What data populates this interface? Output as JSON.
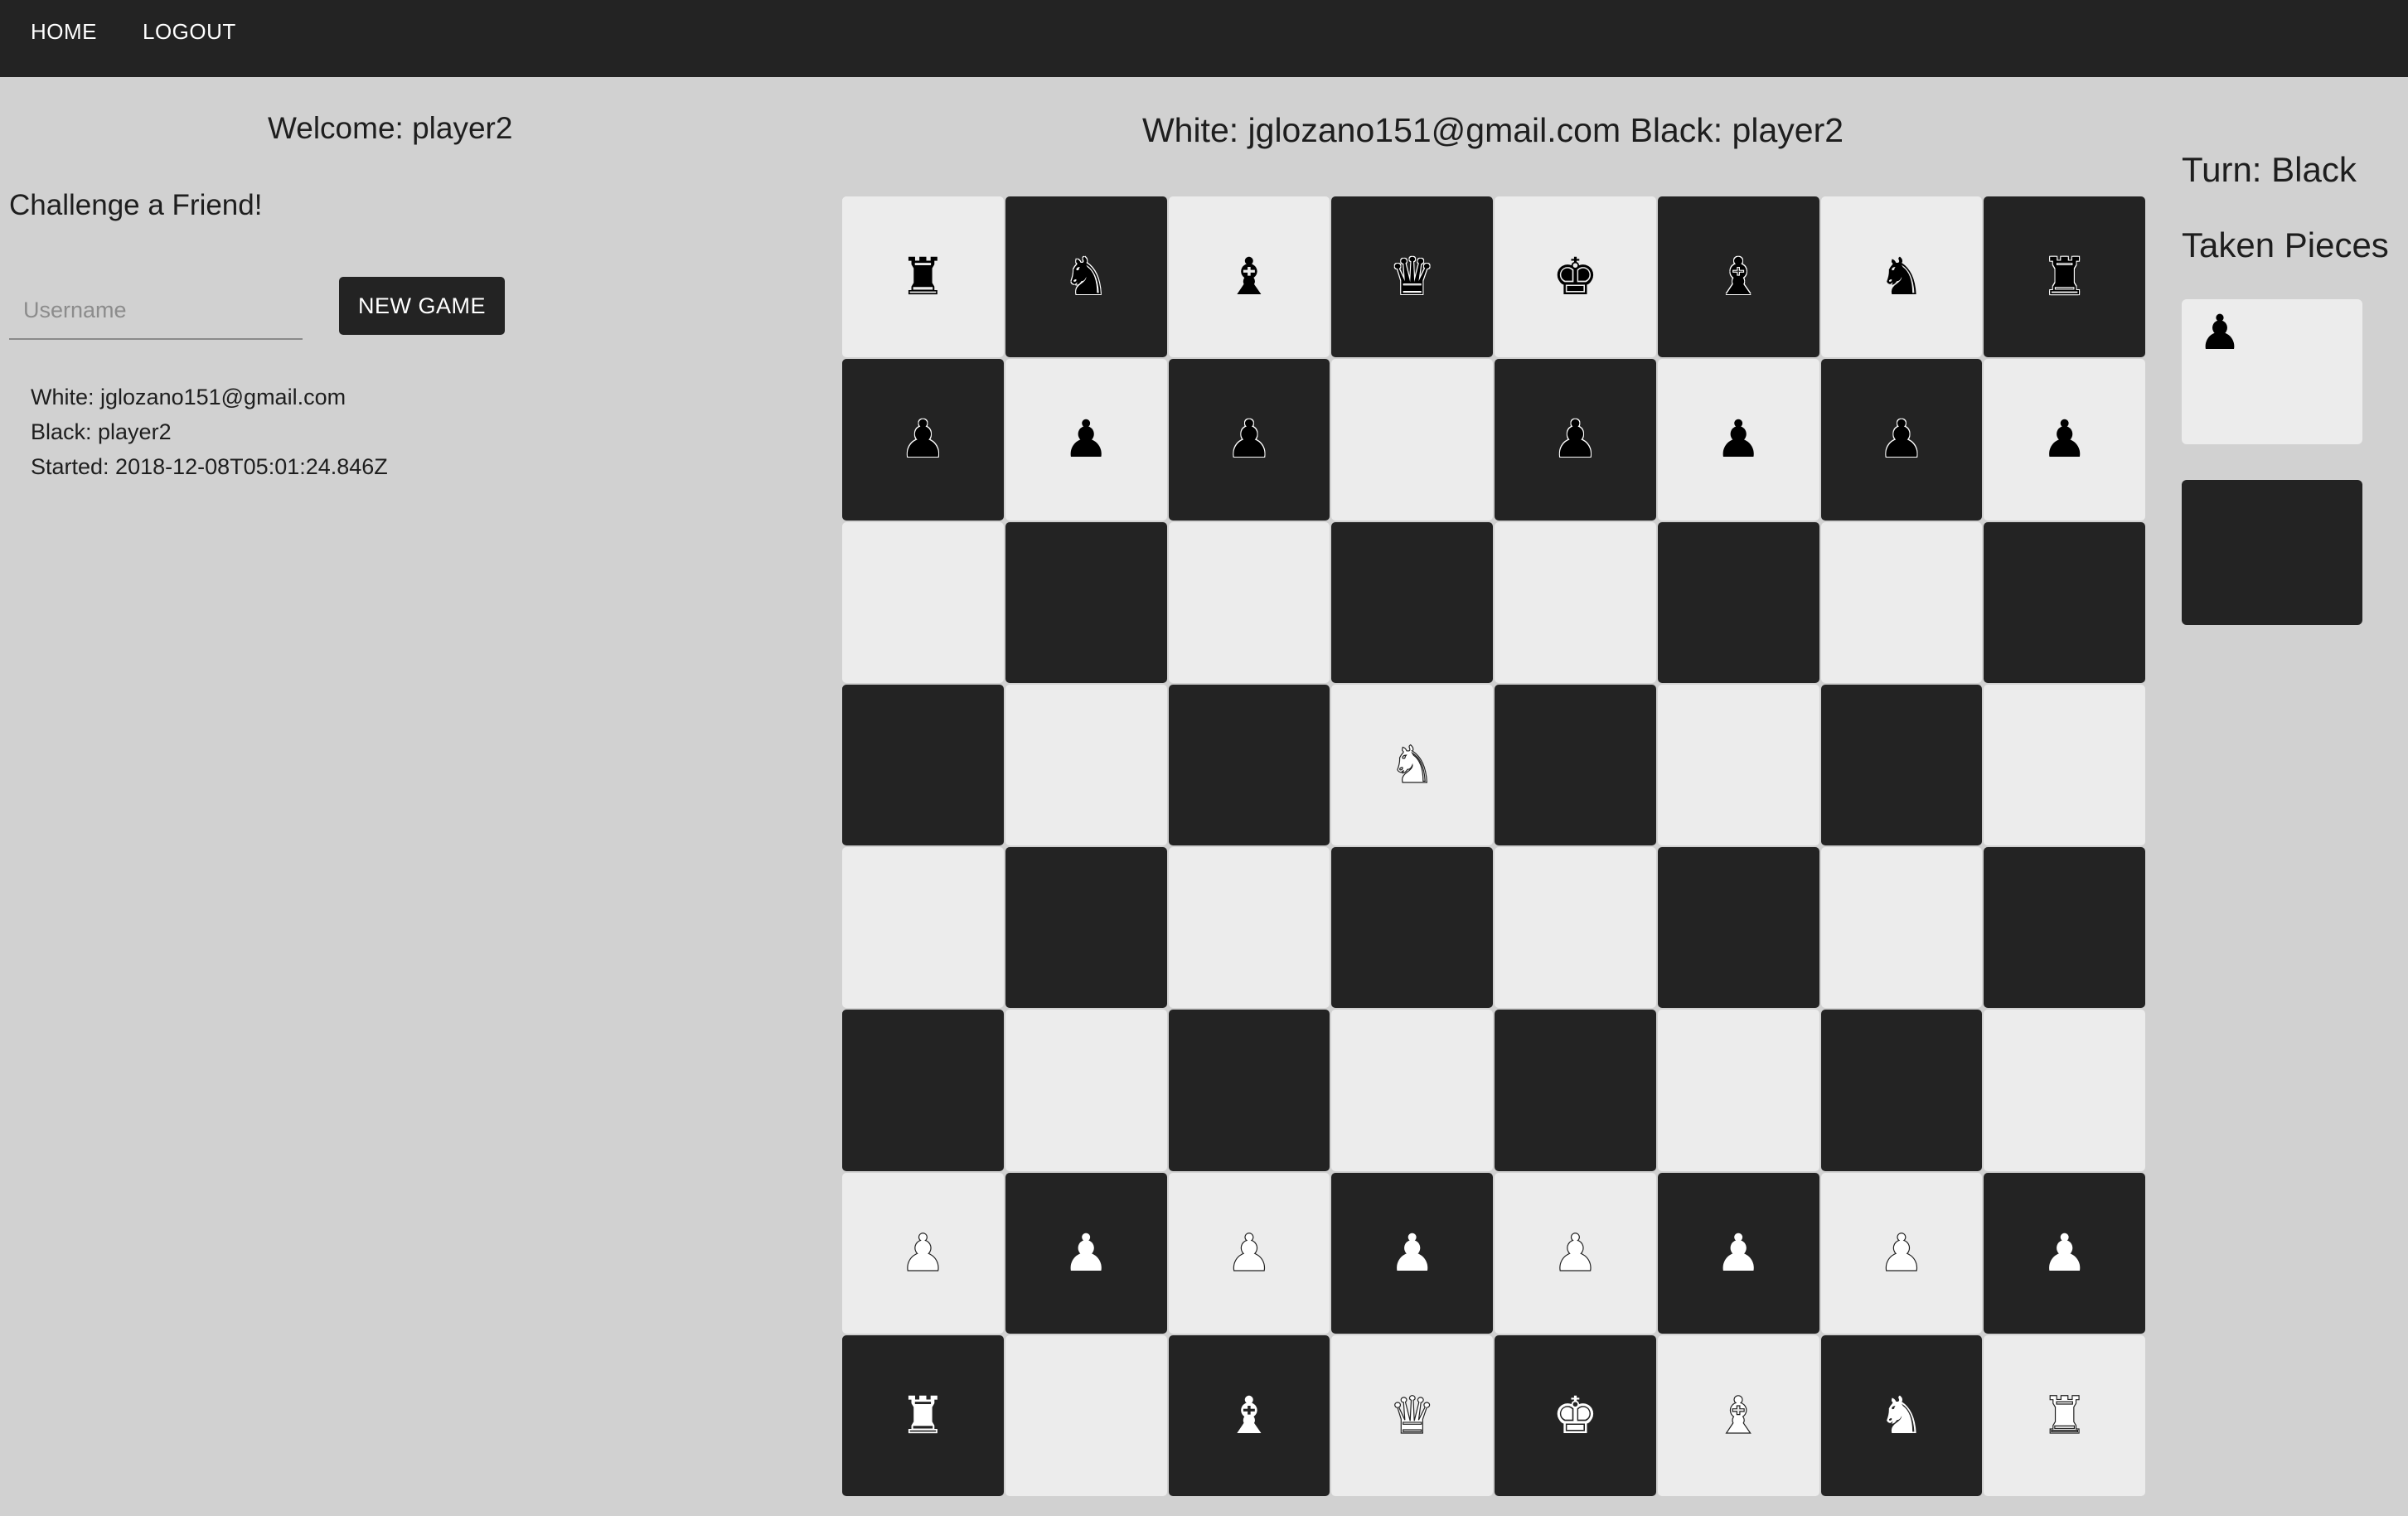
{
  "nav": {
    "home": "HOME",
    "logout": "LOGOUT"
  },
  "sidebar": {
    "welcome": "Welcome: player2",
    "challenge_heading": "Challenge a Friend!",
    "username_placeholder": "Username",
    "username_value": "",
    "new_game_label": "NEW GAME",
    "games": [
      {
        "white": "White: jglozano151@gmail.com",
        "black": "Black: player2",
        "started": "Started: 2018-12-08T05:01:24.846Z"
      }
    ]
  },
  "game": {
    "players_header": "White: jglozano151@gmail.com Black: player2",
    "turn": "Turn: Black",
    "taken_label": "Taken Pieces",
    "taken_by_white": [
      "♟"
    ],
    "taken_by_black": [],
    "board": [
      [
        "br",
        "bn",
        "bb",
        "bq",
        "bk",
        "bb",
        "bn",
        "br"
      ],
      [
        "bp",
        "bp",
        "bp",
        "",
        "bp",
        "bp",
        "bp",
        "bp"
      ],
      [
        "",
        "",
        "",
        "",
        "",
        "",
        "",
        ""
      ],
      [
        "",
        "",
        "",
        "wn",
        "",
        "",
        "",
        ""
      ],
      [
        "",
        "",
        "",
        "",
        "",
        "",
        "",
        ""
      ],
      [
        "",
        "",
        "",
        "",
        "",
        "",
        "",
        ""
      ],
      [
        "wp",
        "wp",
        "wp",
        "wp",
        "wp",
        "wp",
        "wp",
        "wp"
      ],
      [
        "wr",
        "",
        "wb",
        "wq",
        "wk",
        "wb",
        "wn",
        "wr"
      ]
    ]
  },
  "colors": {
    "nav_bg": "#232323",
    "page_bg": "#d1d1d1",
    "light_square": "#ececec",
    "dark_square": "#232323"
  }
}
